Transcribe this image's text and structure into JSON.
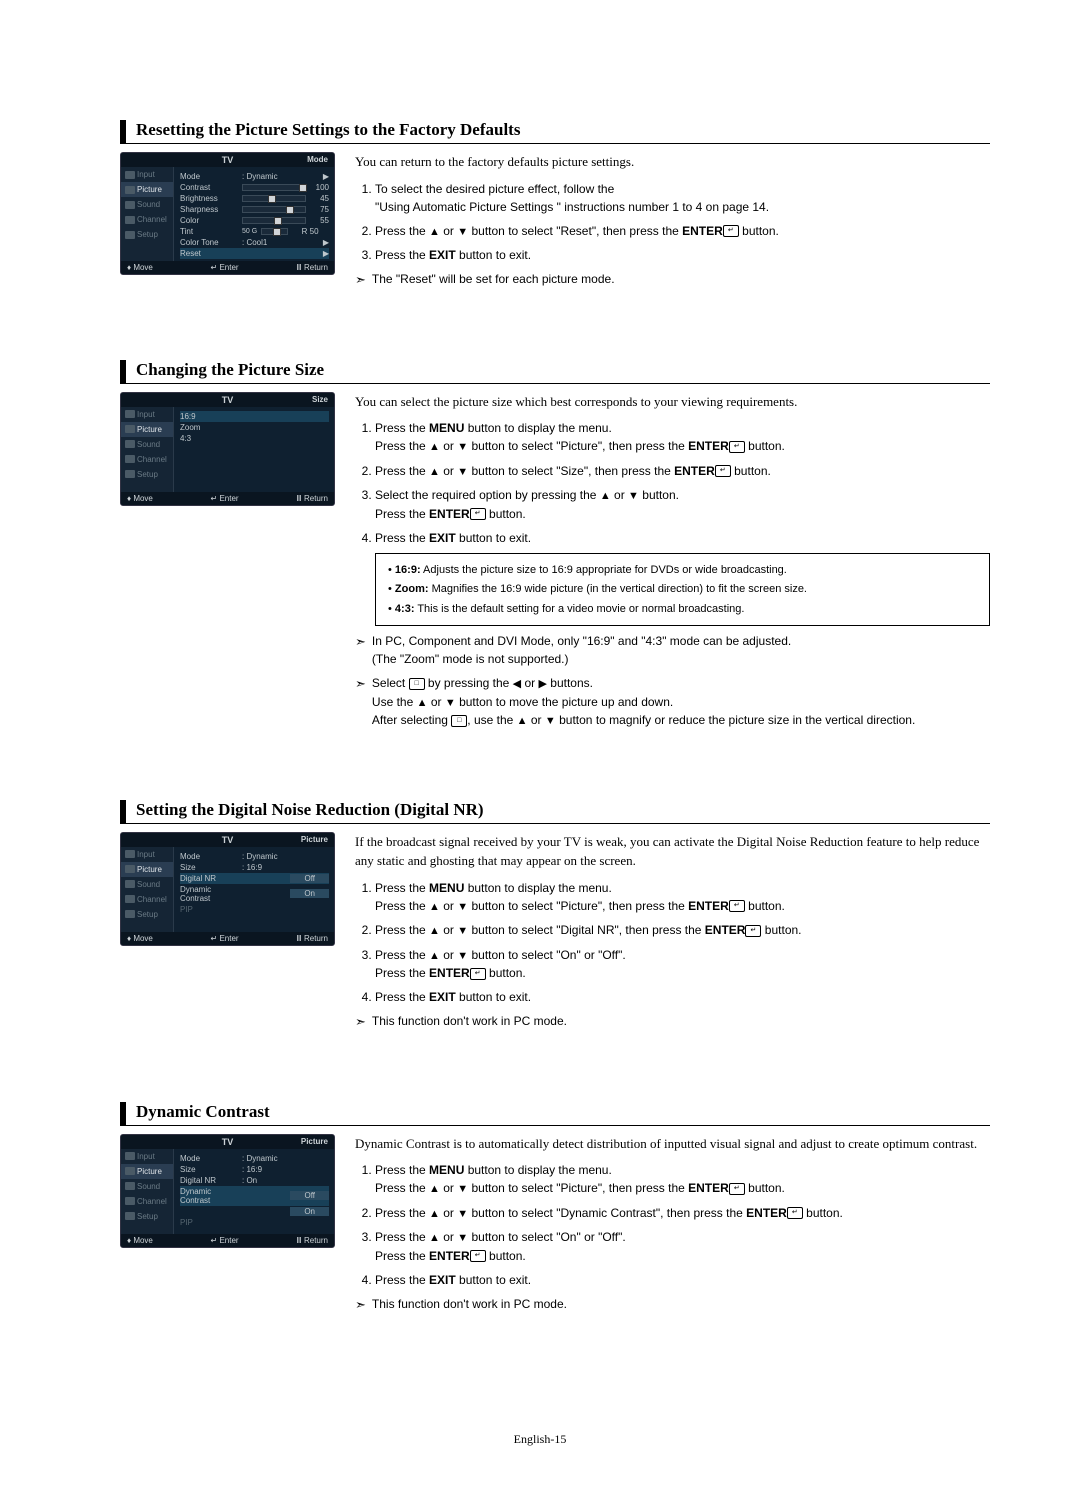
{
  "footer": "English-15",
  "common": {
    "tv": "TV",
    "move": "Move",
    "enter": "Enter",
    "return": "Return",
    "input": "Input",
    "picture": "Picture",
    "sound": "Sound",
    "channel": "Channel",
    "setup": "Setup"
  },
  "sec1": {
    "title": "Resetting the Picture Settings to the Factory Defaults",
    "corner": "Mode",
    "rows": {
      "mode_l": "Mode",
      "mode_v": ": Dynamic",
      "contrast": "Contrast",
      "cv": "100",
      "bright": "Brightness",
      "bv": "45",
      "sharp": "Sharpness",
      "sv": "75",
      "color": "Color",
      "clv": "55",
      "tint": "Tint",
      "tg": "50 G",
      "tr": "R  50",
      "ctone": "Color Tone",
      "ctv": ": Cool1",
      "reset": "Reset"
    },
    "intro": "You can return to the factory defaults  picture settings.",
    "s1a": "To select the desired picture effect, follow the",
    "s1b": "\"Using Automatic Picture Settings \" instructions number 1 to 4 on page 14.",
    "s2a": "Press the ",
    "s2b": " or ",
    "s2c": " button to select \"Reset\", then press the ",
    "s2d": "ENTER",
    "s2e": " button.",
    "s3a": "Press the ",
    "s3b": "EXIT",
    "s3c": " button to exit.",
    "note": "The \"Reset\" will be set for each picture mode."
  },
  "sec2": {
    "title": "Changing the Picture Size",
    "corner": "Size",
    "rows": {
      "r1": "16:9",
      "r2": "Zoom",
      "r3": "4:3"
    },
    "intro": "You can select the picture size which best corresponds to your viewing requirements.",
    "s1a": "Press the ",
    "s1b": "MENU",
    "s1c": " button to display the menu.",
    "s1d": "Press the ",
    "s1e": " or ",
    "s1f": " button to select \"Picture\",  then press the ",
    "s1g": "ENTER",
    "s1h": " button.",
    "s2a": "Press the ",
    "s2b": " or ",
    "s2c": " button to select \"Size\", then press the ",
    "s2d": "ENTER",
    "s2e": " button.",
    "s3a": "Select the required option by pressing the ",
    "s3b": " or ",
    "s3c": " button.",
    "s3d": "Press the ",
    "s3e": "ENTER",
    "s3f": " button.",
    "s4a": "Press the ",
    "s4b": "EXIT",
    "s4c": " button to exit.",
    "b1a": "16:9:",
    "b1b": " Adjusts the picture size to 16:9 appropriate for DVDs or wide broadcasting.",
    "b2a": "Zoom:",
    "b2b": " Magnifies the 16:9 wide picture (in the vertical direction) to fit the screen size.",
    "b3a": "4:3:",
    "b3b": " This is the default setting for a video movie or normal broadcasting.",
    "n1": "In PC, Component and DVI Mode, only \"16:9\" and \"4:3\" mode can be adjusted.",
    "n1b": "(The \"Zoom\" mode is not supported.)",
    "n2a": "Select ",
    "n2b": " by pressing the ",
    "n2c": " or ",
    "n2d": " buttons.",
    "n2e": "Use the ",
    "n2f": " or ",
    "n2g": " button to move the picture up and down.",
    "n2h": "After selecting ",
    "n2i": ", use the ",
    "n2j": " or ",
    "n2k": " button to magnify or reduce the picture size in the vertical direction."
  },
  "sec3": {
    "title": "Setting the Digital Noise Reduction (Digital NR)",
    "corner": "Picture",
    "rows": {
      "mode_l": "Mode",
      "mode_v": ": Dynamic",
      "size_l": "Size",
      "size_v": ": 16:9",
      "dnr_l": "Digital NR",
      "dnr_off": "Off",
      "dc_l": "Dynamic Contrast",
      "dc_on": "On",
      "pip": "PIP"
    },
    "intro": "If the broadcast signal received by your TV is weak, you can activate the Digital Noise Reduction feature to help reduce any static and ghosting that may appear on the screen.",
    "s1a": "Press the ",
    "s1b": "MENU",
    "s1c": " button to display the menu.",
    "s1d": "Press the ",
    "s1e": " or ",
    "s1f": " button to select \"Picture\", then press the ",
    "s1g": "ENTER",
    "s1h": " button.",
    "s2a": "Press the ",
    "s2b": " or ",
    "s2c": " button to select \"Digital NR\", then press the ",
    "s2d": "ENTER",
    "s2e": " button.",
    "s3a": "Press the ",
    "s3b": " or ",
    "s3c": " button to select \"On\" or \"Off\".",
    "s3d": "Press the ",
    "s3e": "ENTER",
    "s3f": " button.",
    "s4a": "Press the ",
    "s4b": "EXIT",
    "s4c": " button to exit.",
    "note": "This function don't work in PC mode."
  },
  "sec4": {
    "title": "Dynamic Contrast",
    "corner": "Picture",
    "rows": {
      "mode_l": "Mode",
      "mode_v": ": Dynamic",
      "size_l": "Size",
      "size_v": ": 16:9",
      "dnr_l": "Digital NR",
      "dnr_v": ": On",
      "dc_l": "Dynamic Contrast",
      "dc_off": "Off",
      "dc_on": "On",
      "pip": "PIP"
    },
    "intro": "Dynamic Contrast is to automatically detect distribution of inputted visual signal and adjust to create optimum contrast.",
    "s1a": "Press the ",
    "s1b": "MENU",
    "s1c": " button to display the menu.",
    "s1d": "Press the ",
    "s1e": " or ",
    "s1f": " button to select \"Picture\",  then press the ",
    "s1g": "ENTER",
    "s1h": " button.",
    "s2a": "Press the ",
    "s2b": " or ",
    "s2c": " button to select \"Dynamic Contrast\", then press the ",
    "s2d": "ENTER",
    "s2e": " button.",
    "s3a": "Press the ",
    "s3b": " or ",
    "s3c": " button to select \"On\" or \"Off\".",
    "s3d": "Press the ",
    "s3e": "ENTER",
    "s3f": " button.",
    "s4a": "Press the ",
    "s4b": "EXIT",
    "s4c": " button to exit.",
    "note": "This function don't work in PC mode."
  }
}
